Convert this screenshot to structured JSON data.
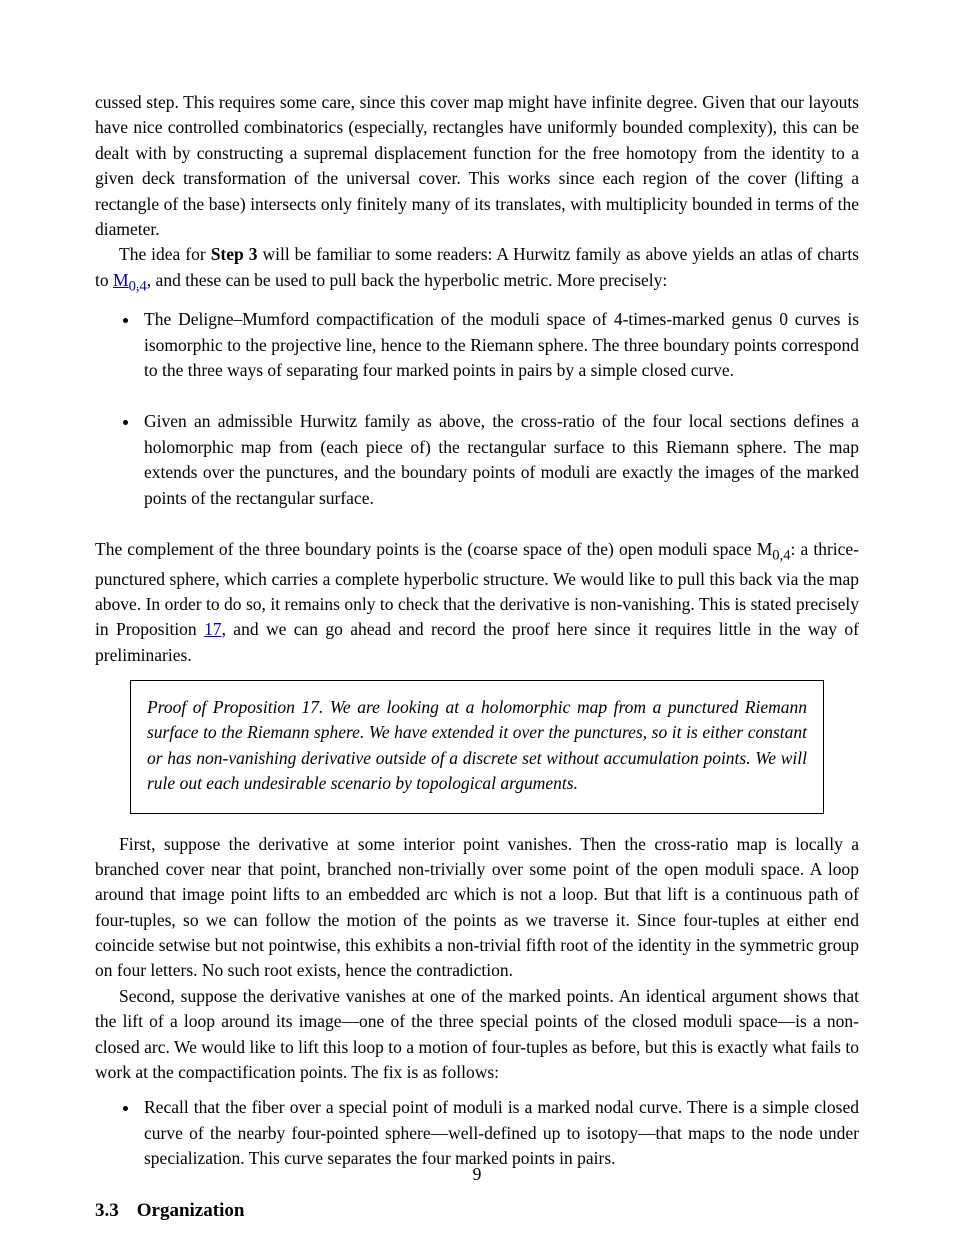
{
  "p1": "cussed step. This requires some care, since this cover map might have infinite degree. Given that our layouts have nice controlled combinatorics (especially, rectangles have uniformly bounded complexity), this can be dealt with by constructing a supremal displacement function for the free homotopy from the identity to a given deck transformation of the universal cover. This works since each region of the cover (lifting a rectangle of the base) intersects only finitely many of its translates, with multiplicity bounded in terms of the diameter.",
  "p2_pre": "The idea for",
  "p2_bold": " Step 3",
  "p2_post": " will be familiar to some readers: A Hurwitz family as above yields an atlas of charts to ",
  "p2_link": "M",
  "p2_sub": "0,4",
  "p2_tail": ", and these can be used to pull back the hyperbolic metric. More precisely:",
  "li1": "The Deligne–Mumford compactification of the moduli space of 4-times-marked genus 0 curves is isomorphic to the projective line, hence to the Riemann sphere. The three boundary points correspond to the three ways of separating four marked points in pairs by a simple closed curve.",
  "li2": "Given an admissible Hurwitz family as above, the cross-ratio of the four local sections defines a holomorphic map from (each piece of) the rectangular surface to this Riemann sphere. The map extends over the punctures, and the boundary points of moduli are exactly the images of the marked points of the rectangular surface.",
  "p3_pre": "The complement of the three boundary points is the (coarse space of the) open moduli space ",
  "p3_link": "M",
  "p3_sub": "0,4",
  "p3_tail": ": a thrice-punctured sphere, which carries a complete hyperbolic structure. We would like to pull this back via the map above. In order to do so, it remains only to check that the derivative is non-vanishing. This is stated precisely in Proposition ",
  "p3_propref": "17",
  "p3_post": ", and we can go ahead and record the proof here since it requires little in the way of preliminaries.",
  "box": "Proof of Proposition 17. We are looking at a holomorphic map from a punctured Riemann surface to the Riemann sphere. We have extended it over the punctures, so it is either constant or has non-vanishing derivative outside of a discrete set without accumulation points. We will rule out each undesirable scenario by topological arguments.",
  "p4": "First, suppose the derivative at some interior point vanishes. Then the cross-ratio map is locally a branched cover near that point, branched non-trivially over some point of the open moduli space. A loop around that image point lifts to an embedded arc which is not a loop. But that lift is a continuous path of four-tuples, so we can follow the motion of the points as we traverse it. Since four-tuples at either end coincide setwise but not pointwise, this exhibits a non-trivial fifth root of the identity in the symmetric group on four letters. No such root exists, hence the contradiction.",
  "p5": "Second, suppose the derivative vanishes at one of the marked points. An identical argument shows that the lift of a loop around its image—one of the three special points of the closed moduli space—is a non-closed arc. We would like to lift this loop to a motion of four-tuples as before, but this is exactly what fails to work at the compactification points. The fix is as follows:",
  "li3": "Recall that the fiber over a special point of moduli is a marked nodal curve. There is a simple closed curve of the nearby four-pointed sphere—well-defined up to isotopy—that maps to the node under specialization. This curve separates the four marked points in pairs.",
  "secnum": "3.3",
  "sectitle": "Organization",
  "pagenum": "9"
}
